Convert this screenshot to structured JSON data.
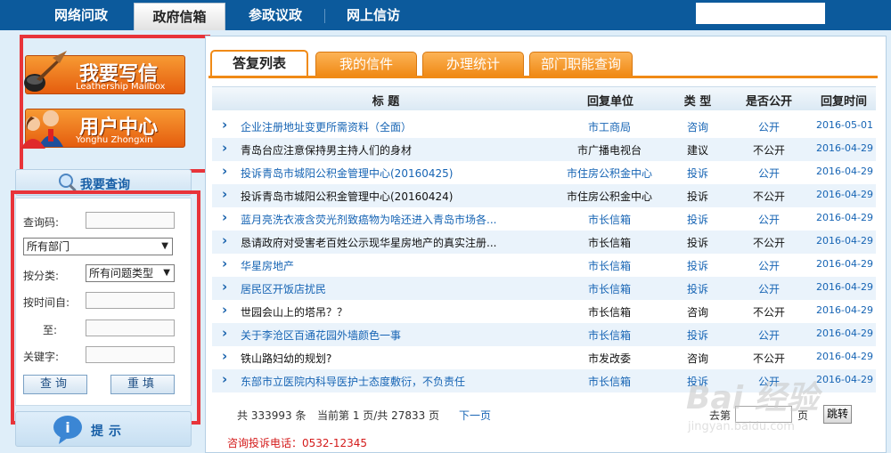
{
  "topnav": {
    "tabs": [
      {
        "label": "网络问政"
      },
      {
        "label": "政府信箱",
        "active": true
      },
      {
        "label": "参政议政"
      },
      {
        "label": "网上信访"
      }
    ]
  },
  "left": {
    "write_letter": {
      "title": "我要写信",
      "subtitle": "Leathership Mailbox"
    },
    "user_center": {
      "title": "用户中心",
      "subtitle": "Yonghu Zhongxin"
    },
    "query_header": "我要查询",
    "form": {
      "code_label": "查询码:",
      "dept_select": "所有部门",
      "category_label": "按分类:",
      "category_select": "所有问题类型",
      "time_from_label": "按时间自:",
      "time_to_label": "至:",
      "keyword_label": "关键字:",
      "search_button": "查询",
      "reset_button": "重填"
    },
    "tip_header": "提示"
  },
  "main": {
    "tabs": [
      {
        "label": "答复列表",
        "active": true
      },
      {
        "label": "我的信件"
      },
      {
        "label": "办理统计"
      },
      {
        "label": "部门职能查询"
      }
    ],
    "columns": {
      "title": "标  题",
      "unit": "回复单位",
      "type": "类  型",
      "public": "是否公开",
      "date": "回复时间"
    },
    "rows": [
      {
        "title": "企业注册地址变更所需资料（全面）",
        "unit": "市工商局",
        "type": "咨询",
        "public": "公开",
        "date": "2016-05-01",
        "style": "blue"
      },
      {
        "title": "青岛台应注意保持男主持人们的身材",
        "unit": "市广播电视台",
        "type": "建议",
        "public": "不公开",
        "date": "2016-04-29",
        "style": "dark"
      },
      {
        "title": "投诉青岛市城阳公积金管理中心(20160425)",
        "unit": "市住房公积金中心",
        "type": "投诉",
        "public": "公开",
        "date": "2016-04-29",
        "style": "blue"
      },
      {
        "title": "投诉青岛市城阳公积金管理中心(20160424)",
        "unit": "市住房公积金中心",
        "type": "投诉",
        "public": "不公开",
        "date": "2016-04-29",
        "style": "dark"
      },
      {
        "title": "蓝月亮洗衣液含荧光剂致癌物为啥还进入青岛市场各...",
        "unit": "市长信箱",
        "type": "投诉",
        "public": "公开",
        "date": "2016-04-29",
        "style": "blue"
      },
      {
        "title": "恳请政府对受害老百姓公示现华星房地产的真实注册...",
        "unit": "市长信箱",
        "type": "投诉",
        "public": "不公开",
        "date": "2016-04-29",
        "style": "dark"
      },
      {
        "title": "华星房地产",
        "unit": "市长信箱",
        "type": "投诉",
        "public": "公开",
        "date": "2016-04-29",
        "style": "blue"
      },
      {
        "title": "居民区开饭店扰民",
        "unit": "市长信箱",
        "type": "投诉",
        "public": "公开",
        "date": "2016-04-29",
        "style": "blue"
      },
      {
        "title": "世园会山上的塔吊？？",
        "unit": "市长信箱",
        "type": "咨询",
        "public": "不公开",
        "date": "2016-04-29",
        "style": "dark"
      },
      {
        "title": "关于李沧区百通花园外墙颜色一事",
        "unit": "市长信箱",
        "type": "投诉",
        "public": "公开",
        "date": "2016-04-29",
        "style": "blue"
      },
      {
        "title": "铁山路妇幼的规划?",
        "unit": "市发改委",
        "type": "咨询",
        "public": "不公开",
        "date": "2016-04-29",
        "style": "dark"
      },
      {
        "title": "东部市立医院内科导医护士态度敷衍，不负责任",
        "unit": "市长信箱",
        "type": "投诉",
        "public": "公开",
        "date": "2016-04-29",
        "style": "blue"
      }
    ],
    "pager": {
      "total": "共 333993 条",
      "current": "当前第 1 页/共 27833 页",
      "next": "下一页",
      "goto_prefix": "去第",
      "goto_suffix": "页",
      "goto_button": "跳转"
    },
    "hotline": "咨询投诉电话：0532-12345"
  },
  "watermark": {
    "text": "Bai 经验",
    "sub": "jingyan.baidu.com"
  },
  "colors": {
    "nav": "#0c5a9c",
    "accent_orange": "#f08a16",
    "link_blue": "#1664b4",
    "highlight_red": "#e8343a"
  }
}
